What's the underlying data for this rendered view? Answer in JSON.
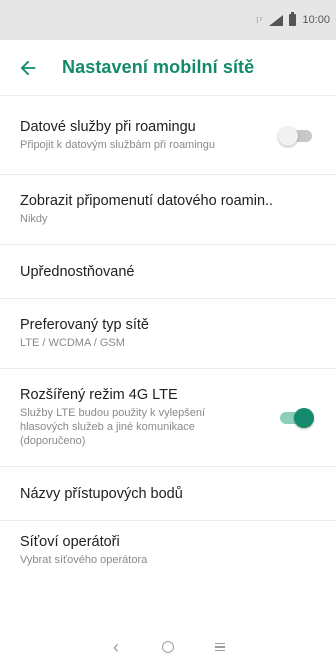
{
  "status_bar": {
    "time": "10:00"
  },
  "app_bar": {
    "title": "Nastavení mobilní sítě",
    "back_icon": "arrow-back-icon"
  },
  "colors": {
    "accent": "#128a6b",
    "toggle_on": "#138a6c"
  },
  "settings": [
    {
      "title": "Datové služby při roamingu",
      "subtitle": "Připojit k datovým službám při roamingu",
      "toggle": "off"
    },
    {
      "title": "Zobrazit připomenutí datového roamin..",
      "subtitle": "Nikdy"
    },
    {
      "title": "Upřednostňované"
    },
    {
      "title": "Preferovaný typ sítě",
      "subtitle": "LTE / WCDMA / GSM"
    },
    {
      "title": "Rozšířený režim 4G LTE",
      "subtitle": "Služby LTE budou použity k vylepšení hlasových služeb a jiné komunikace (doporučeno)",
      "toggle": "on"
    },
    {
      "title": "Názvy přístupových bodů"
    },
    {
      "title": "Síťoví operátoři",
      "subtitle": "Vybrat síťového operátora"
    }
  ],
  "nav_bar": {
    "back": "‹"
  }
}
